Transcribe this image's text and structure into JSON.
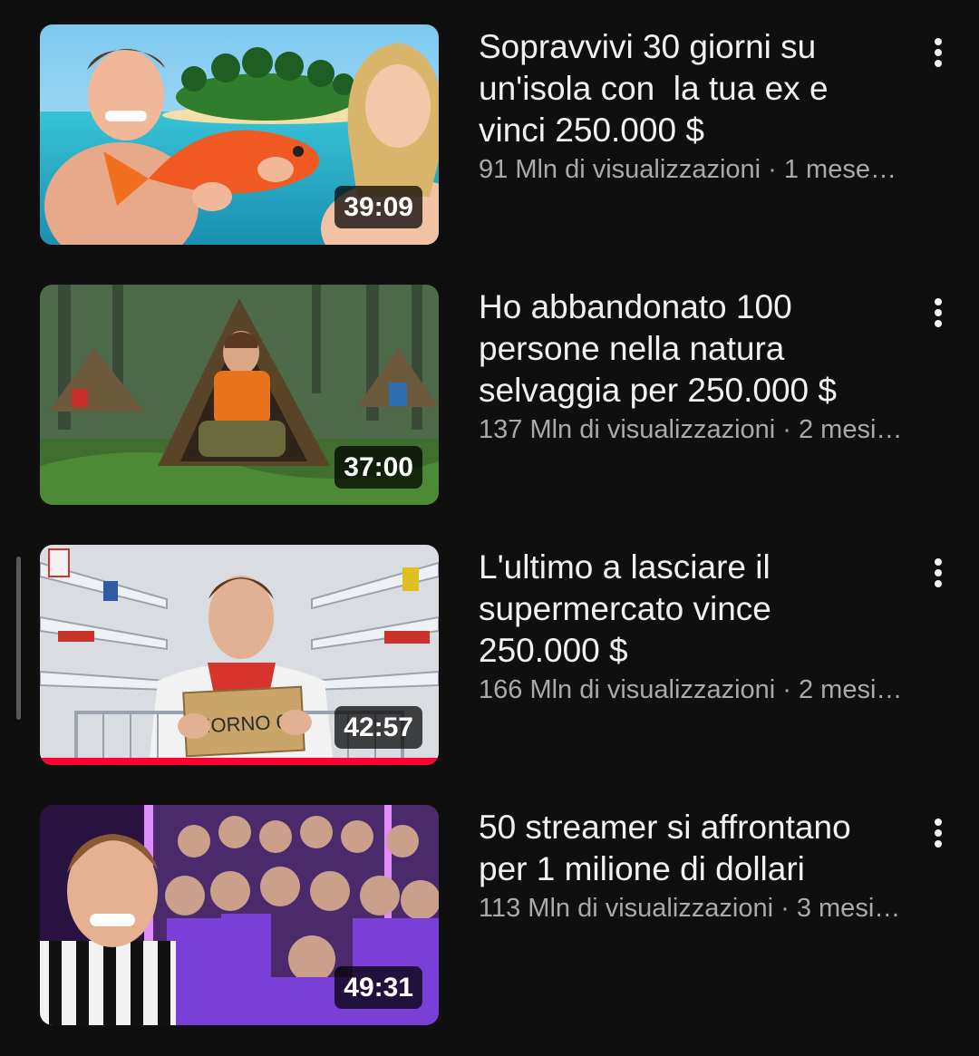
{
  "videos": [
    {
      "title": "Sopravvivi 30 giorni su\nun'isola con  la tua ex e\nvinci 250.000 $",
      "views": "91 Mln di visualizzazioni",
      "age": "1 mese…",
      "duration": "39:09",
      "thumbnail_icon": "island-fish-thumbnail",
      "watch_progress": 0
    },
    {
      "title": "Ho abbandonato 100\npersone nella natura\nselvaggia per 250.000 $",
      "views": "137 Mln di visualizzazioni",
      "age": "2 mesi…",
      "duration": "37:00",
      "thumbnail_icon": "forest-shelter-thumbnail",
      "watch_progress": 0
    },
    {
      "title": "L'ultimo a lasciare il\nsupermercato vince\n250.000 $",
      "views": "166 Mln di visualizzazioni",
      "age": "2 mesi…",
      "duration": "42:57",
      "thumbnail_icon": "supermarket-thumbnail",
      "thumbnail_sign": "GIORNO 67",
      "watch_progress": 1.0
    },
    {
      "title": "50 streamer si affrontano\nper 1 milione di dollari",
      "views": "113 Mln di visualizzazioni",
      "age": "3 mesi…",
      "duration": "49:31",
      "thumbnail_icon": "streamers-crowd-thumbnail",
      "watch_progress": 0
    }
  ],
  "separator": " · ",
  "colors": {
    "background": "#0f0f0f",
    "title": "#f1f1f1",
    "meta": "#aaaaaa",
    "progress": "#ff0033"
  }
}
